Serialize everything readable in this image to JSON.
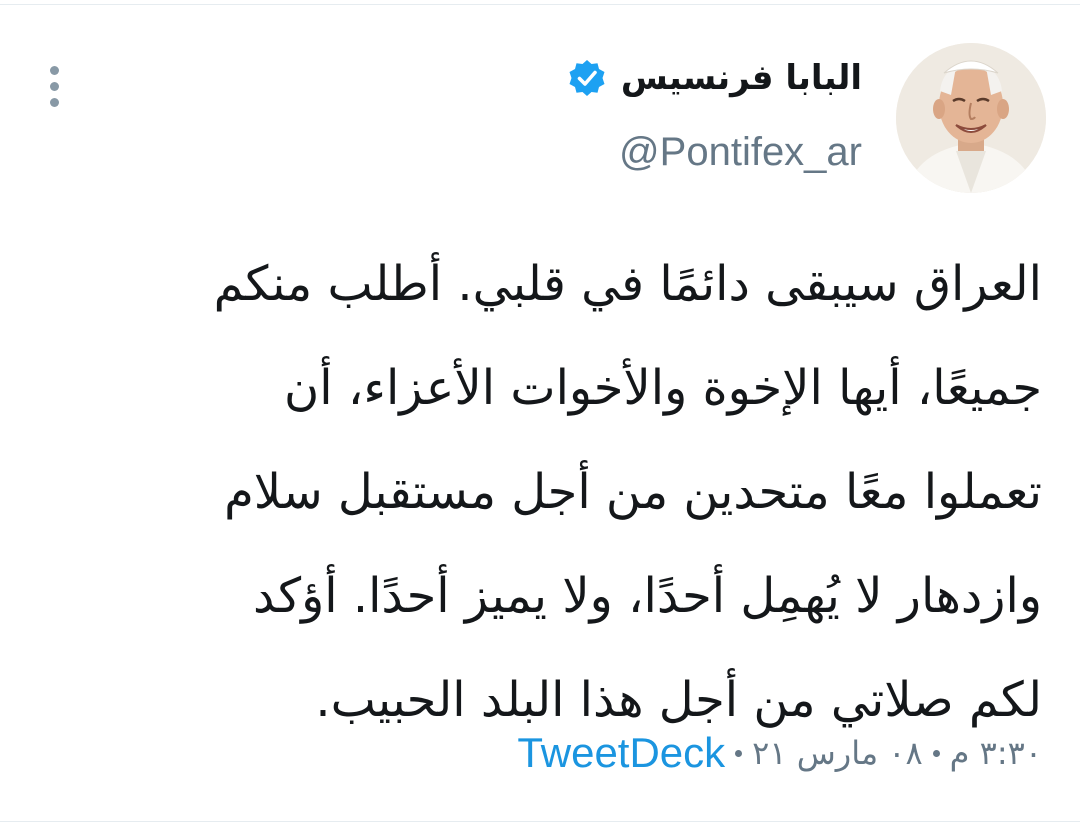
{
  "author": {
    "display_name": "البابا فرنسيس",
    "handle": "@Pontifex_ar",
    "verified": true
  },
  "tweet": {
    "lines": [
      "العراق سيبقى دائمًا في قلبي. أطلب منكم",
      "جميعًا، أيها الإخوة والأخوات الأعزاء، أن",
      "تعملوا معًا متحدين من أجل مستقبل سلام",
      "وازدهار لا يُهمِل أحدًا، ولا يميز أحدًا. أؤكد",
      "لكم صلاتي من أجل هذا البلد الحبيب."
    ]
  },
  "meta": {
    "time": "٣:٣٠ م",
    "date": "٠٨ مارس ٢١",
    "source": "TweetDeck"
  },
  "icons": {
    "verified": "verified-badge-icon",
    "more": "more-vertical-icon"
  },
  "colors": {
    "verified": "#1da1f2",
    "link": "#1b95e0",
    "text": "#14171a",
    "muted": "#657786"
  }
}
